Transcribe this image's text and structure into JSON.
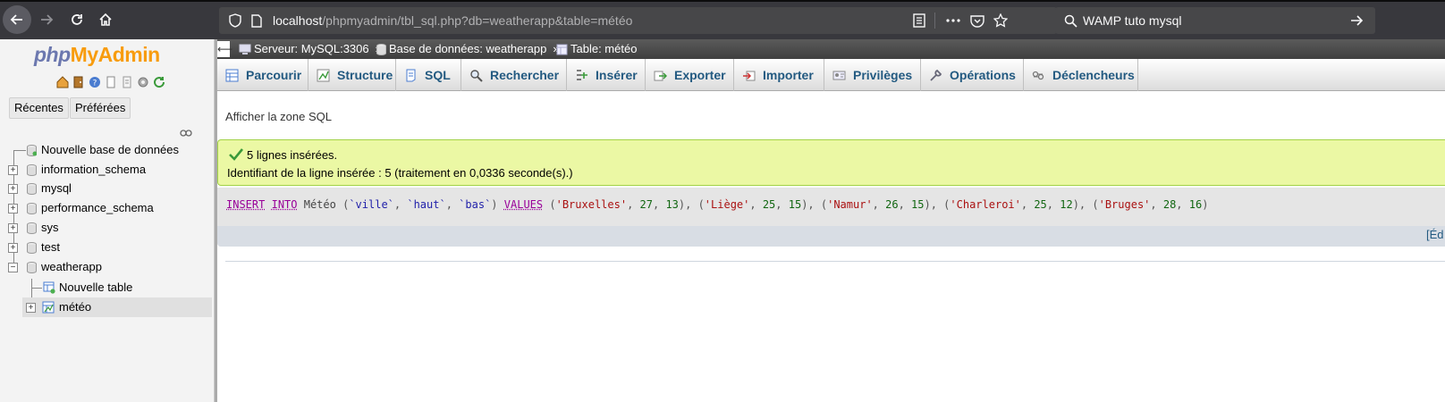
{
  "browser": {
    "url_host": "localhost",
    "url_rest": "/phpmyadmin/tbl_sql.php?db=weatherapp&table=météo",
    "search_query": "WAMP tuto mysql"
  },
  "nav": {
    "logo_php": "php",
    "logo_myadmin": "MyAdmin",
    "tab_recentes": "Récentes",
    "tab_preferees": "Préférées",
    "tree": [
      {
        "label": "Nouvelle base de données"
      },
      {
        "label": "information_schema"
      },
      {
        "label": "mysql"
      },
      {
        "label": "performance_schema"
      },
      {
        "label": "sys"
      },
      {
        "label": "test"
      },
      {
        "label": "weatherapp"
      },
      {
        "label": "Nouvelle table"
      },
      {
        "label": "météo"
      }
    ]
  },
  "breadcrumb": {
    "server": "Serveur: MySQL:3306",
    "database": "Base de données: weatherapp",
    "table": "Table: météo",
    "separator": "»"
  },
  "tabs": [
    {
      "label": "Parcourir",
      "icon": "browse-icon"
    },
    {
      "label": "Structure",
      "icon": "structure-icon"
    },
    {
      "label": "SQL",
      "icon": "sql-icon"
    },
    {
      "label": "Rechercher",
      "icon": "search-icon"
    },
    {
      "label": "Insérer",
      "icon": "insert-icon"
    },
    {
      "label": "Exporter",
      "icon": "export-icon"
    },
    {
      "label": "Importer",
      "icon": "import-icon"
    },
    {
      "label": "Privilèges",
      "icon": "privileges-icon"
    },
    {
      "label": "Opérations",
      "icon": "wrench-icon"
    },
    {
      "label": "Déclencheurs",
      "icon": "triggers-icon"
    }
  ],
  "main": {
    "sql_toggle": "Afficher la zone SQL",
    "success_line1": "5 lignes insérées.",
    "success_line2": "Identifiant de la ligne insérée : 5 (traitement en 0,0336 seconde(s).)",
    "edit_link": "[Éd",
    "sql": {
      "kw_insert": "INSERT",
      "kw_into": "INTO",
      "table": "Météo",
      "columns": [
        "`ville`",
        "`haut`",
        "`bas`"
      ],
      "kw_values": "VALUES",
      "rows": [
        {
          "ville": "'Bruxelles'",
          "haut": "27",
          "bas": "13"
        },
        {
          "ville": "'Liège'",
          "haut": "25",
          "bas": "15"
        },
        {
          "ville": "'Namur'",
          "haut": "26",
          "bas": "15"
        },
        {
          "ville": "'Charleroi'",
          "haut": "25",
          "bas": "12"
        },
        {
          "ville": "'Bruges'",
          "haut": "28",
          "bas": "16"
        }
      ]
    }
  },
  "colors": {
    "chrome_bg": "#38383d",
    "success_bg": "#ebf8a4",
    "tab_text": "#235a81",
    "logo_php": "#6c78af",
    "logo_myadmin": "#f89c0e"
  }
}
